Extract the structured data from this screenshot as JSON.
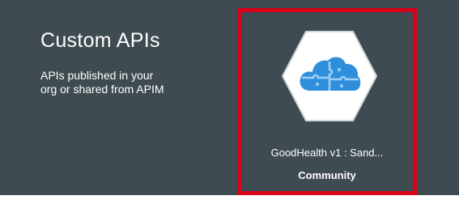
{
  "section": {
    "title": "Custom APIs",
    "description_line1": "APIs published in your",
    "description_line2": "org or shared from APIM"
  },
  "api_card": {
    "name": "GoodHealth v1 : Sand...",
    "tier": "Community",
    "icon": "cloud-puzzle-icon",
    "highlight_color": "#d9001b"
  },
  "colors": {
    "panel_bg": "#3e4b50",
    "icon_blue": "#2f8fdc",
    "icon_light": "#9fd0f5"
  }
}
